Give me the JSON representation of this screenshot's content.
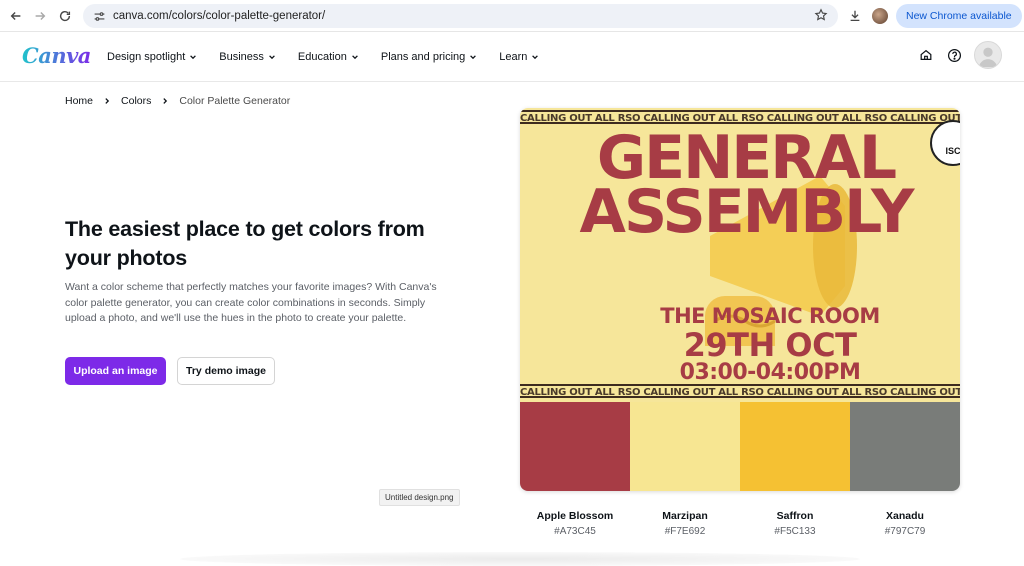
{
  "browser": {
    "url": "canva.com/colors/color-palette-generator/",
    "new_chrome_label": "New Chrome available"
  },
  "header": {
    "logo": "Canva",
    "nav": [
      {
        "label": "Design spotlight"
      },
      {
        "label": "Business"
      },
      {
        "label": "Education"
      },
      {
        "label": "Plans and pricing"
      },
      {
        "label": "Learn"
      }
    ]
  },
  "breadcrumb": {
    "items": [
      "Home",
      "Colors",
      "Color Palette Generator"
    ]
  },
  "hero": {
    "title": "The easiest place to get colors from your photos",
    "description": "Want a color scheme that perfectly matches your favorite images? With Canva's color palette generator, you can create color combinations in seconds. Simply upload a photo, and we'll use the hues in the photo to create your palette.",
    "upload_label": "Upload an image",
    "demo_label": "Try demo image",
    "tooltip": "Untitled design.png"
  },
  "poster": {
    "ticker": "CALLING OUT ALL RSO CALLING OUT ALL RSO CALLING OUT ALL RSO CALLING OUT ALL RSO CALLING OUT ALL RSO",
    "line1": "GENERAL",
    "line2": "ASSEMBLY",
    "venue": "THE MOSAIC ROOM",
    "date": "29TH OCT",
    "time": "03:00-04:00PM",
    "badge": "ISC"
  },
  "palette": [
    {
      "name": "Apple Blossom",
      "hex": "#A73C45",
      "color": "#a73c45"
    },
    {
      "name": "Marzipan",
      "hex": "#F7E692",
      "color": "#f7e692"
    },
    {
      "name": "Saffron",
      "hex": "#F5C133",
      "color": "#f5c133"
    },
    {
      "name": "Xanadu",
      "hex": "#797C79",
      "color": "#797c79"
    }
  ],
  "icons": {
    "back": "arrow-left-icon",
    "forward": "arrow-right-icon",
    "reload": "reload-icon",
    "site_info": "tune-icon",
    "bookmark": "star-icon",
    "download": "download-icon",
    "home": "home-icon",
    "help": "help-icon"
  }
}
